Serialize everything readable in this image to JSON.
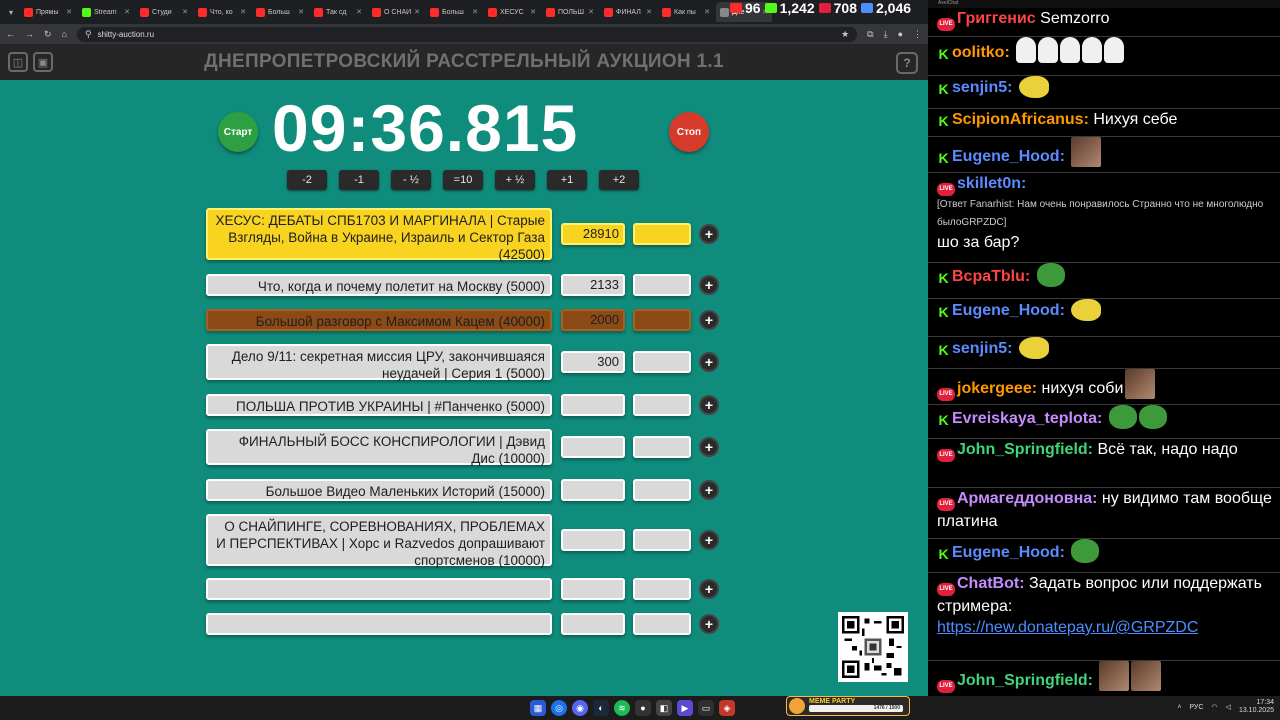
{
  "browser": {
    "tabs": [
      {
        "label": "Прямы",
        "color": "#ff2b2b"
      },
      {
        "label": "Stream",
        "color": "#53fc18"
      },
      {
        "label": "Студи",
        "color": "#ff2b2b"
      },
      {
        "label": "Что, ко",
        "color": "#ff2b2b"
      },
      {
        "label": "Больш",
        "color": "#ff2b2b"
      },
      {
        "label": "Так сд",
        "color": "#ff2b2b"
      },
      {
        "label": "О СНАЙ",
        "color": "#ff2b2b"
      },
      {
        "label": "Больш",
        "color": "#ff2b2b"
      },
      {
        "label": "ХЕСУС",
        "color": "#ff2b2b"
      },
      {
        "label": "ПОЛЬШ",
        "color": "#ff2b2b"
      },
      {
        "label": "ФИНАЛ",
        "color": "#ff2b2b"
      },
      {
        "label": "Как пы",
        "color": "#ff2b2b"
      },
      {
        "label": "Днe",
        "color": "#888888",
        "active": true
      }
    ],
    "url": "shitty-auction.ru"
  },
  "overlay_stats": [
    {
      "icon": "youtube-icon",
      "value": "96",
      "color": "#ff2b2b"
    },
    {
      "icon": "kick-icon",
      "value": "1,242",
      "color": "#53fc18"
    },
    {
      "icon": "live-icon",
      "value": "708",
      "color": "#e21f3d"
    },
    {
      "icon": "viewers-icon",
      "value": "2,046",
      "color": "#4c8eff"
    }
  ],
  "page": {
    "title": "ДНЕПРОПЕТРОВСКИЙ РАССТРЕЛЬНЫЙ АУКЦИОН 1.1",
    "help": "?",
    "timer": "09:36.815",
    "start_label": "Старт",
    "stop_label": "Стоп",
    "adjust_buttons": [
      "-2",
      "-1",
      "- ½",
      "=10",
      "+ ½",
      "+1",
      "+2"
    ],
    "lots": [
      {
        "name": "ХЕСУС: ДЕБАТЫ СПБ1703 И МАРГИНАЛА | Старые Взгляды, Война в Украине, Израиль и Сектор Газа (42500)",
        "amount": "28910",
        "style": "gold"
      },
      {
        "name": "Что, когда и почему полетит на Москву (5000)",
        "amount": "2133",
        "style": "gray"
      },
      {
        "name": "Большой разговор с Максимом Кацем (40000)",
        "amount": "2000",
        "style": "brown"
      },
      {
        "name": "Дело 9/11: секретная миссия ЦРУ, закончившаяся неудачей | Серия 1 (5000)",
        "amount": "300",
        "style": "gray"
      },
      {
        "name": "ПОЛЬША ПРОТИВ УКРАИНЫ | #Панченко (5000)",
        "amount": "",
        "style": "gray"
      },
      {
        "name": "ФИНАЛЬНЫЙ БОСС КОНСПИРОЛОГИИ | Дэвид Дис (10000)",
        "amount": "",
        "style": "gray"
      },
      {
        "name": "Большое Видео Маленьких Историй (15000)",
        "amount": "",
        "style": "gray"
      },
      {
        "name": "О СНАЙПИНГЕ, СОРЕВНОВАНИЯХ, ПРОБЛЕМАХ И ПЕРСПЕКТИВАХ | Хорс и Razvedos допрашивают спортсменов (10000)",
        "amount": "",
        "style": "gray"
      },
      {
        "name": "",
        "amount": "",
        "style": "gray"
      },
      {
        "name": "",
        "amount": "",
        "style": "gray"
      }
    ],
    "add_label": "+"
  },
  "chat": {
    "window_title": "AxelChat",
    "messages": [
      {
        "platform": "live",
        "user": "Григгенис",
        "user_color": "#ff4444",
        "text": "Semzorro",
        "emotes": [
          "flag"
        ]
      },
      {
        "platform": "kick",
        "user": "oolitko:",
        "user_color": "#ff9900",
        "text": "",
        "emotes": [
          "ghost",
          "ghost",
          "ghost",
          "ghost",
          "ghost"
        ]
      },
      {
        "platform": "kick",
        "user": "senjin5:",
        "user_color": "#5b8cff",
        "text": "",
        "emotes": [
          "bird"
        ]
      },
      {
        "platform": "kick",
        "user": "ScipionAfricanus:",
        "user_color": "#ff9900",
        "text": "Нихуя себе",
        "emotes": []
      },
      {
        "platform": "kick",
        "user": "Eugene_Hood:",
        "user_color": "#5b8cff",
        "text": "",
        "emotes": [
          "pic"
        ]
      },
      {
        "platform": "live",
        "user": "skillet0n:",
        "user_color": "#5b8cff",
        "reply": "[Ответ Fanarhist: Нам очень понравилось Странно что не многолюдно былоGRPZDC]",
        "text": "шо за бар?",
        "emotes": []
      },
      {
        "platform": "kick",
        "user": "ВсраТblu:",
        "user_color": "#ff4444",
        "text": "",
        "emotes": [
          "frog"
        ]
      },
      {
        "platform": "kick",
        "user": "Eugene_Hood:",
        "user_color": "#5b8cff",
        "text": "",
        "emotes": [
          "bird"
        ]
      },
      {
        "platform": "kick",
        "user": "senjin5:",
        "user_color": "#5b8cff",
        "text": "",
        "emotes": [
          "bird"
        ]
      },
      {
        "platform": "live",
        "user": "jokergeee:",
        "user_color": "#ff9900",
        "text": "нихуя соби",
        "emotes": [
          "pic"
        ]
      },
      {
        "platform": "kick",
        "user": "Evreiskaya_teplota:",
        "user_color": "#c58cff",
        "text": "",
        "emotes": [
          "frog",
          "frog"
        ]
      },
      {
        "platform": "live",
        "user": "John_Springfield:",
        "user_color": "#3fd67a",
        "text": "Всё так, надо надо",
        "emotes": []
      },
      {
        "platform": "live",
        "user": "Армагеддоновна:",
        "user_color": "#c58cff",
        "text": "ну видимо там вообще платина",
        "emotes": []
      },
      {
        "platform": "kick",
        "user": "Eugene_Hood:",
        "user_color": "#5b8cff",
        "text": "",
        "emotes": [
          "frog"
        ]
      },
      {
        "platform": "live",
        "user": "ChatBot:",
        "user_color": "#c58cff",
        "text": "Задать вопрос или поддержать стримера:",
        "link": "https://new.donatepay.ru/@GRPZDC",
        "emotes": []
      },
      {
        "platform": "live",
        "user": "John_Springfield:",
        "user_color": "#3fd67a",
        "text": "",
        "emotes": [
          "pic",
          "pic"
        ]
      }
    ]
  },
  "taskbar": {
    "meme_title": "MEME PARTY",
    "meme_progress": "1476 / 1500",
    "lang": "РУС",
    "time": "17:34",
    "date": "13.10.2025"
  }
}
